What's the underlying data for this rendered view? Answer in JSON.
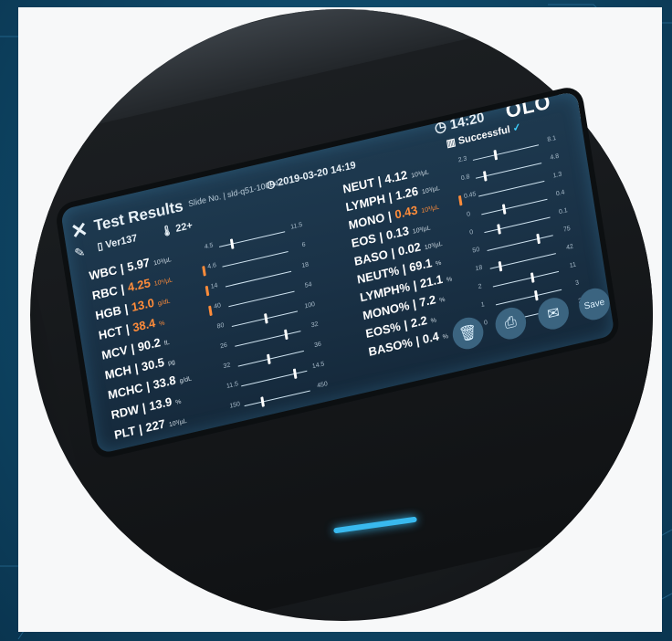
{
  "header": {
    "title": "Test Results",
    "slide_label": "Slide No. | sld-q51-10004",
    "datetime": "2019-03-20 14:19",
    "version": "Ver137",
    "temperature": "22+",
    "time": "14:20",
    "logo": "OLO",
    "status": "Successful",
    "status_icon": "check-icon"
  },
  "left_results": [
    {
      "name": "WBC",
      "value": "5.97",
      "unit": "10³/µL",
      "abnormal": false,
      "low": "4.5",
      "high": "11.5",
      "pos": 0.18
    },
    {
      "name": "RBC",
      "value": "4.25",
      "unit": "10⁶/µL",
      "abnormal": true,
      "low": "4.6",
      "high": "6",
      "pos": 0
    },
    {
      "name": "HGB",
      "value": "13.0",
      "unit": "g/dL",
      "abnormal": true,
      "low": "14",
      "high": "18",
      "pos": 0
    },
    {
      "name": "HCT",
      "value": "38.4",
      "unit": "%",
      "abnormal": true,
      "low": "40",
      "high": "54",
      "pos": 0
    },
    {
      "name": "MCV",
      "value": "90.2",
      "unit": "fL",
      "abnormal": false,
      "low": "80",
      "high": "100",
      "pos": 0.5
    },
    {
      "name": "MCH",
      "value": "30.5",
      "unit": "pg",
      "abnormal": false,
      "low": "26",
      "high": "32",
      "pos": 0.75
    },
    {
      "name": "MCHC",
      "value": "33.8",
      "unit": "g/dL",
      "abnormal": false,
      "low": "32",
      "high": "36",
      "pos": 0.45
    },
    {
      "name": "RDW",
      "value": "13.9",
      "unit": "%",
      "abnormal": false,
      "low": "11.5",
      "high": "14.5",
      "pos": 0.8
    },
    {
      "name": "PLT",
      "value": "227",
      "unit": "10³/µL",
      "abnormal": false,
      "low": "150",
      "high": "450",
      "pos": 0.26
    }
  ],
  "right_results": [
    {
      "name": "NEUT",
      "value": "4.12",
      "unit": "10³/µL",
      "abnormal": false,
      "low": "2.3",
      "high": "8.1",
      "pos": 0.32
    },
    {
      "name": "LYMPH",
      "value": "1.26",
      "unit": "10³/µL",
      "abnormal": false,
      "low": "0.8",
      "high": "4.8",
      "pos": 0.12
    },
    {
      "name": "MONO",
      "value": "0.43",
      "unit": "10³/µL",
      "abnormal": true,
      "low": "0.45",
      "high": "1.3",
      "pos": 0
    },
    {
      "name": "EOS",
      "value": "0.13",
      "unit": "10³/µL",
      "abnormal": false,
      "low": "0",
      "high": "0.4",
      "pos": 0.32
    },
    {
      "name": "BASO",
      "value": "0.02",
      "unit": "10³/µL",
      "abnormal": false,
      "low": "0",
      "high": "0.1",
      "pos": 0.2
    },
    {
      "name": "NEUT%",
      "value": "69.1",
      "unit": "%",
      "abnormal": false,
      "low": "50",
      "high": "75",
      "pos": 0.76
    },
    {
      "name": "LYMPH%",
      "value": "21.1",
      "unit": "%",
      "abnormal": false,
      "low": "18",
      "high": "42",
      "pos": 0.13
    },
    {
      "name": "MONO%",
      "value": "7.2",
      "unit": "%",
      "abnormal": false,
      "low": "2",
      "high": "11",
      "pos": 0.58
    },
    {
      "name": "EOS%",
      "value": "2.2",
      "unit": "%",
      "abnormal": false,
      "low": "1",
      "high": "3",
      "pos": 0.6
    },
    {
      "name": "BASO%",
      "value": "0.4",
      "unit": "%",
      "abnormal": false,
      "low": "0",
      "high": "2",
      "pos": 0.2
    }
  ],
  "actions": {
    "delete_icon": "trash-icon",
    "print_icon": "printer-icon",
    "email_icon": "envelope-icon",
    "save_label": "Save"
  },
  "colors": {
    "abnormal": "#ff8c3a",
    "screen_bg": "#1a3247",
    "accent": "#39b9ee"
  }
}
